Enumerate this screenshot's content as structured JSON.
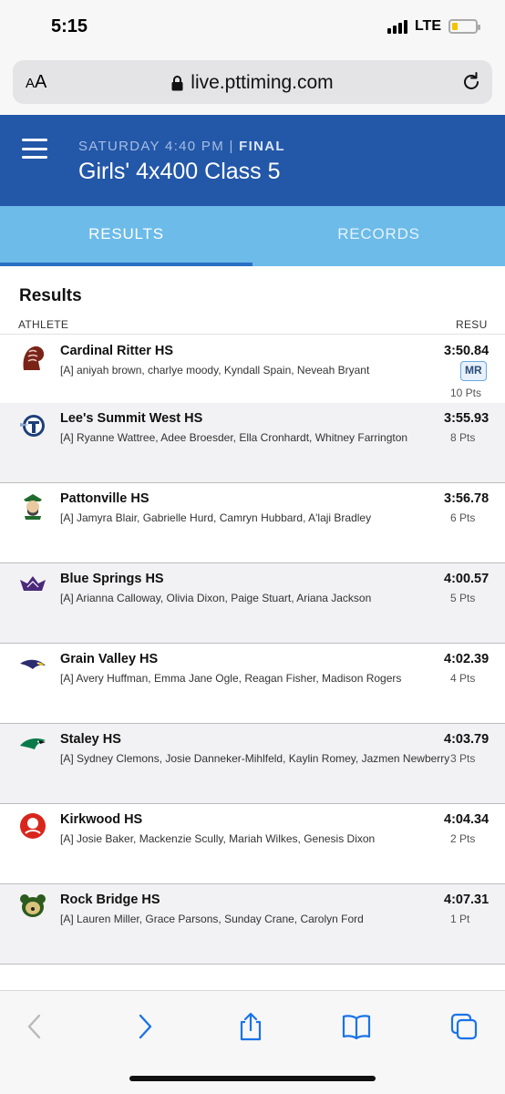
{
  "status_bar": {
    "time": "5:15",
    "network": "LTE"
  },
  "browser": {
    "text_size_label": "A",
    "text_size_label_large": "A",
    "url": "live.pttiming.com"
  },
  "header": {
    "day_time": "SATURDAY 4:40 PM |",
    "state": "FINAL",
    "title": "Girls' 4x400 Class 5"
  },
  "tabs": {
    "results": "RESULTS",
    "records": "RECORDS"
  },
  "results": {
    "title": "Results",
    "col_athlete": "ATHLETE",
    "col_result": "RESULT",
    "rows": [
      {
        "team": "Cardinal Ritter HS",
        "athletes": "[A] aniyah brown, charlye moody, Kyndall Spain, Neveah Bryant",
        "time": "3:50.84",
        "badge": "MR",
        "points": "10 Pts",
        "logo": "lion-logo-icon"
      },
      {
        "team": "Lee's Summit West HS",
        "athletes": "[A] Ryanne Wattree, Adee Broesder, Ella Cronhardt, Whitney Farrington",
        "time": "3:55.93",
        "points": "8 Pts",
        "logo": "titan-logo-icon"
      },
      {
        "team": "Pattonville HS",
        "athletes": "[A] Jamyra Blair, Gabrielle Hurd, Camryn Hubbard, A'laji Bradley",
        "time": "3:56.78",
        "points": "6 Pts",
        "logo": "pirate-logo-icon"
      },
      {
        "team": "Blue Springs HS",
        "athletes": "[A] Arianna Calloway, Olivia Dixon, Paige Stuart, Ariana Jackson",
        "time": "4:00.57",
        "points": "5 Pts",
        "logo": "wildcat-logo-icon"
      },
      {
        "team": "Grain Valley HS",
        "athletes": "[A] Avery Huffman, Emma Jane Ogle, Reagan Fisher, Madison Rogers",
        "time": "4:02.39",
        "points": "4 Pts",
        "logo": "eagle-logo-icon"
      },
      {
        "team": "Staley HS",
        "athletes": "[A] Sydney Clemons, Josie Danneker-Mihlfeld, Kaylin Romey, Jazmen Newberry",
        "time": "4:03.79",
        "points": "3 Pts",
        "logo": "falcon-logo-icon"
      },
      {
        "team": "Kirkwood HS",
        "athletes": "[A] Josie Baker, Mackenzie Scully, Mariah Wilkes, Genesis Dixon",
        "time": "4:04.34",
        "points": "2 Pts",
        "logo": "pioneer-logo-icon"
      },
      {
        "team": "Rock Bridge HS",
        "athletes": "[A] Lauren Miller, Grace Parsons, Sunday Crane, Carolyn Ford",
        "time": "4:07.31",
        "points": "1 Pt",
        "logo": "bruin-logo-icon"
      }
    ]
  },
  "colors": {
    "header_blue": "#2357a8",
    "tab_bar_blue": "#6cbbe8",
    "safari_blue": "#1a73e8"
  }
}
